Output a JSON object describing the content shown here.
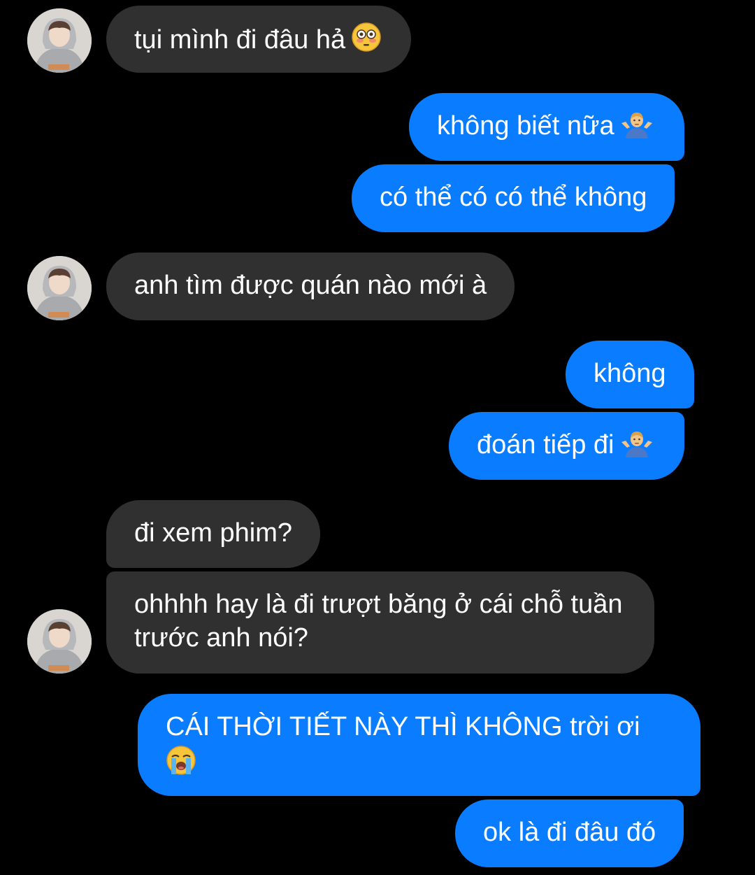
{
  "conversation": {
    "messages": [
      {
        "id": "m1",
        "sender": "contact",
        "text": "tụi mình đi đâu hả",
        "emoji": "flushed-face-icon"
      },
      {
        "id": "m2",
        "sender": "self",
        "text": "không biết nữa",
        "emoji": "man-shrugging-icon"
      },
      {
        "id": "m3",
        "sender": "self",
        "text": "có thể có có thể không"
      },
      {
        "id": "m4",
        "sender": "contact",
        "text": "anh tìm được quán nào mới à"
      },
      {
        "id": "m5",
        "sender": "self",
        "text": "không"
      },
      {
        "id": "m6",
        "sender": "self",
        "text": "đoán tiếp đi",
        "emoji": "man-shrugging-icon"
      },
      {
        "id": "m7",
        "sender": "contact",
        "text": "đi xem phim?"
      },
      {
        "id": "m8",
        "sender": "contact",
        "text": "ohhhh hay là đi trượt băng ở cái chỗ tuần trước anh nói?"
      },
      {
        "id": "m9",
        "sender": "self",
        "text": "CÁI THỜI TIẾT NÀY THÌ KHÔNG trời ơi",
        "emoji": "loudly-crying-face-icon"
      },
      {
        "id": "m10",
        "sender": "self",
        "text": "ok là đi đâu đó"
      }
    ]
  },
  "colors": {
    "background": "#000000",
    "incoming_bubble": "#303030",
    "outgoing_bubble": "#0a7cff",
    "text": "#ffffff"
  }
}
